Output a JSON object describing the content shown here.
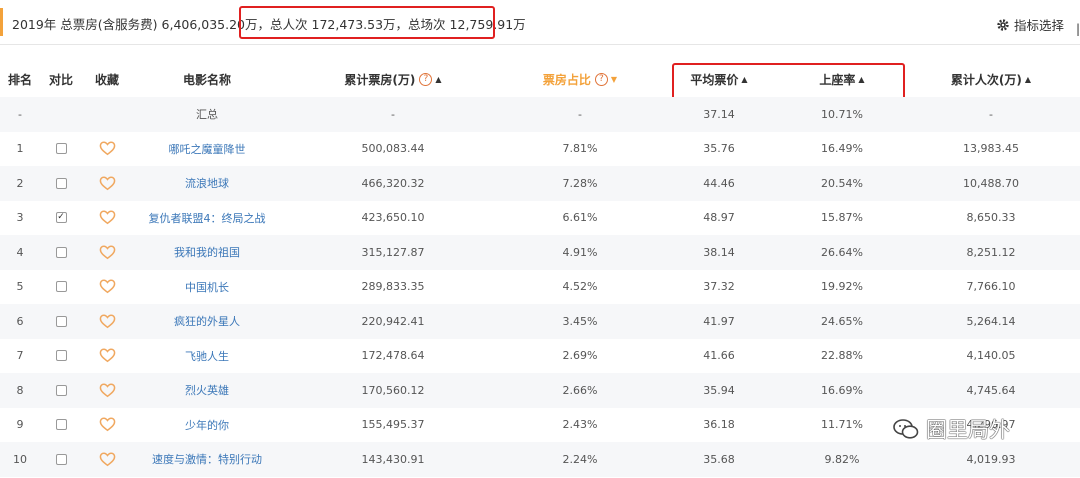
{
  "top": {
    "summary_prefix": "2019年 总票房(含服务费) 6,406,035.20万，",
    "summary_highlight": "总人次 172,473.53万，总场次 12,759.91万",
    "indicator_label": "指标选择"
  },
  "table": {
    "headers": {
      "rank": "排名",
      "compare": "对比",
      "favorite": "收藏",
      "name": "电影名称",
      "box_office": "累计票房(万)",
      "share": "票房占比",
      "avg_price": "平均票价",
      "occupancy": "上座率",
      "admissions": "累计人次(万)"
    },
    "summary_row": {
      "rank": "-",
      "name": "汇总",
      "box_office": "-",
      "share": "-",
      "avg_price": "37.14",
      "occupancy": "10.71%",
      "admissions": "-"
    },
    "rows": [
      {
        "rank": "1",
        "checked": false,
        "name": "哪吒之魔童降世",
        "box_office": "500,083.44",
        "share": "7.81%",
        "avg_price": "35.76",
        "occupancy": "16.49%",
        "admissions": "13,983.45"
      },
      {
        "rank": "2",
        "checked": false,
        "name": "流浪地球",
        "box_office": "466,320.32",
        "share": "7.28%",
        "avg_price": "44.46",
        "occupancy": "20.54%",
        "admissions": "10,488.70"
      },
      {
        "rank": "3",
        "checked": true,
        "name": "复仇者联盟4：终局之战",
        "box_office": "423,650.10",
        "share": "6.61%",
        "avg_price": "48.97",
        "occupancy": "15.87%",
        "admissions": "8,650.33"
      },
      {
        "rank": "4",
        "checked": false,
        "name": "我和我的祖国",
        "box_office": "315,127.87",
        "share": "4.91%",
        "avg_price": "38.14",
        "occupancy": "26.64%",
        "admissions": "8,251.12"
      },
      {
        "rank": "5",
        "checked": false,
        "name": "中国机长",
        "box_office": "289,833.35",
        "share": "4.52%",
        "avg_price": "37.32",
        "occupancy": "19.92%",
        "admissions": "7,766.10"
      },
      {
        "rank": "6",
        "checked": false,
        "name": "疯狂的外星人",
        "box_office": "220,942.41",
        "share": "3.45%",
        "avg_price": "41.97",
        "occupancy": "24.65%",
        "admissions": "5,264.14"
      },
      {
        "rank": "7",
        "checked": false,
        "name": "飞驰人生",
        "box_office": "172,478.64",
        "share": "2.69%",
        "avg_price": "41.66",
        "occupancy": "22.88%",
        "admissions": "4,140.05"
      },
      {
        "rank": "8",
        "checked": false,
        "name": "烈火英雄",
        "box_office": "170,560.12",
        "share": "2.66%",
        "avg_price": "35.94",
        "occupancy": "16.69%",
        "admissions": "4,745.64"
      },
      {
        "rank": "9",
        "checked": false,
        "name": "少年的你",
        "box_office": "155,495.37",
        "share": "2.43%",
        "avg_price": "36.18",
        "occupancy": "11.71%",
        "admissions": "4,296.97"
      },
      {
        "rank": "10",
        "checked": false,
        "name": "速度与激情：特别行动",
        "box_office": "143,430.91",
        "share": "2.24%",
        "avg_price": "35.68",
        "occupancy": "9.82%",
        "admissions": "4,019.93"
      }
    ]
  },
  "watermark": {
    "text": "圈里局外"
  },
  "colors": {
    "accent": "#f3a23b",
    "highlight_box": "#e02020",
    "link": "#3b77b8",
    "heart": "#f0a860"
  }
}
